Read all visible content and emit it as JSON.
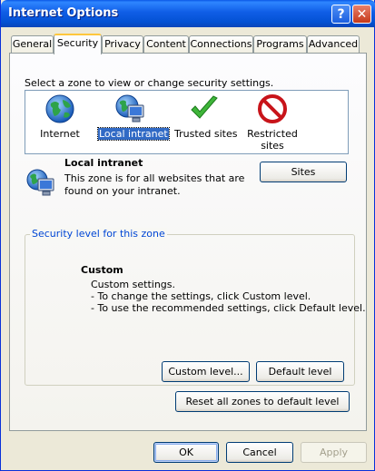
{
  "window": {
    "title": "Internet Options"
  },
  "titlebar": {
    "help_glyph": "?",
    "close_glyph": "✕"
  },
  "tabs": [
    {
      "label": "General",
      "active": false
    },
    {
      "label": "Security",
      "active": true
    },
    {
      "label": "Privacy",
      "active": false
    },
    {
      "label": "Content",
      "active": false
    },
    {
      "label": "Connections",
      "active": false
    },
    {
      "label": "Programs",
      "active": false
    },
    {
      "label": "Advanced",
      "active": false
    }
  ],
  "security": {
    "instruction": "Select a zone to view or change security settings.",
    "zones": [
      {
        "label": "Internet",
        "icon": "globe-icon",
        "selected": false
      },
      {
        "label": "Local intranet",
        "icon": "local-intranet-icon",
        "selected": true
      },
      {
        "label": "Trusted sites",
        "icon": "checkmark-icon",
        "selected": false
      },
      {
        "label_line1": "Restricted",
        "label_line2": "sites",
        "icon": "restricted-icon",
        "selected": false
      }
    ],
    "zone_info": {
      "title": "Local intranet",
      "desc_line1": "This zone is for all websites that are",
      "desc_line2": "found on your intranet."
    },
    "sites_button": "Sites",
    "group_title": "Security level for this zone",
    "level": {
      "title": "Custom",
      "line1": "Custom settings.",
      "line2": "- To change the settings, click Custom level.",
      "line3": "- To use the recommended settings, click Default level."
    },
    "custom_level_button": "Custom level...",
    "default_level_button": "Default level",
    "reset_button": "Reset all zones to default level"
  },
  "footer": {
    "ok": "OK",
    "cancel": "Cancel",
    "apply": "Apply"
  },
  "colors": {
    "titlebar_blue": "#0452d4",
    "selection_blue": "#316ac5",
    "group_title_blue": "#0046d5",
    "dialog_bg": "#ece9d8"
  }
}
